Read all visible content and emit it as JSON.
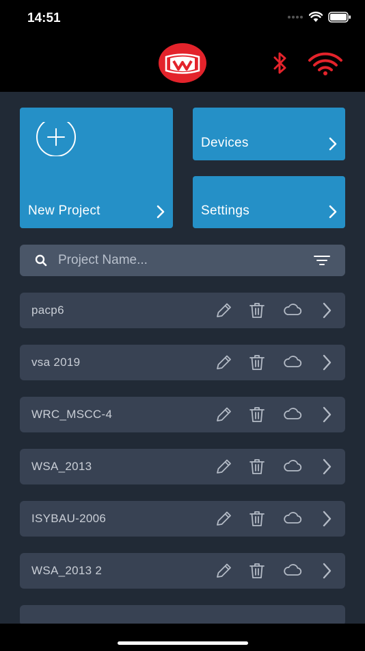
{
  "status": {
    "time": "14:51"
  },
  "colors": {
    "accent": "#2590c7",
    "brand_red": "#e3232b",
    "row_bg": "#384253",
    "content_bg": "#212a36"
  },
  "header": {
    "logo_icon": "brand-logo",
    "bluetooth_icon": "bluetooth-icon",
    "wifi_icon": "wifi-icon"
  },
  "tiles": {
    "new_project": "New Project",
    "devices": "Devices",
    "settings": "Settings"
  },
  "search": {
    "placeholder": "Project Name..."
  },
  "projects": [
    {
      "name": "pacp6"
    },
    {
      "name": "vsa 2019"
    },
    {
      "name": "WRC_MSCC-4"
    },
    {
      "name": "WSA_2013"
    },
    {
      "name": "ISYBAU-2006"
    },
    {
      "name": "WSA_2013 2"
    }
  ]
}
